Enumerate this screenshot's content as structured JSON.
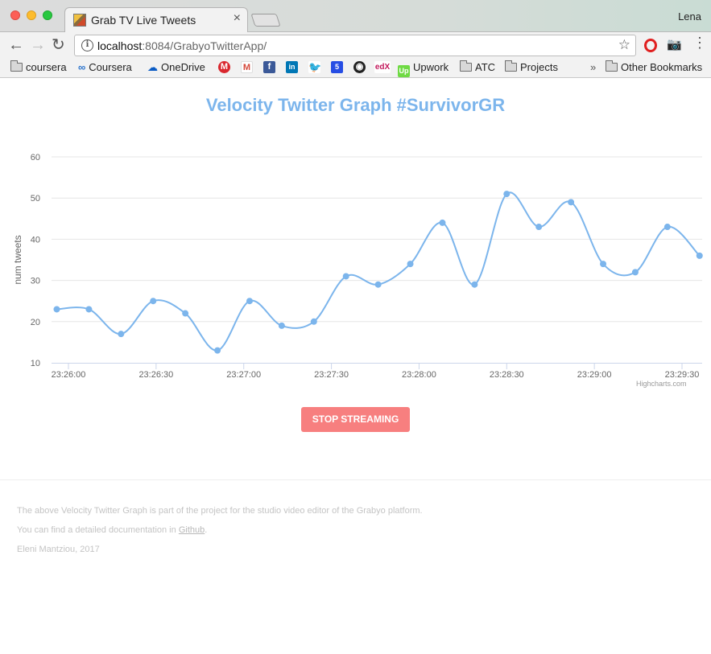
{
  "browser": {
    "tab_title": "Grab TV Live Tweets",
    "tab_close": "×",
    "profile_name": "Lena",
    "back_glyph": "←",
    "forward_glyph": "→",
    "reload_glyph": "↻",
    "info_glyph": "i",
    "url_host": "localhost",
    "url_rest": ":8084/GrabyoTwitterApp/",
    "star_glyph": "☆",
    "camera_glyph": "📷",
    "menu_glyph": "⋮",
    "bookmarks": {
      "coursera_folder": "coursera",
      "coursera": "Coursera",
      "onedrive": "OneDrive",
      "upwork": "Upwork",
      "atc": "ATC",
      "projects": "Projects",
      "overflow": "»",
      "other": "Other Bookmarks"
    },
    "bookmark_icons": [
      "mega-icon",
      "gmail-icon",
      "facebook-icon",
      "linkedin-icon",
      "twitter-icon",
      "html5-icon",
      "github-icon",
      "edx-icon",
      "upwork-icon"
    ]
  },
  "page": {
    "title": "Velocity Twitter Graph #SurvivorGR",
    "stop_button": "STOP STREAMING",
    "credits": "Highcharts.com",
    "footer": {
      "line1": "The above Velocity Twitter Graph is part of the project for the studio video editor of the Grabyo platform.",
      "line2_prefix": "You can find a detailed documentation in ",
      "line2_link": "Github",
      "line2_suffix": ".",
      "line3": "Eleni Mantziou, 2017"
    }
  },
  "colors": {
    "series": "#7cb5ec",
    "button": "#f77f7f",
    "grid": "#e6e6e6"
  },
  "chart_data": {
    "type": "line",
    "title": "Velocity Twitter Graph #SurvivorGR",
    "ylabel": "num tweets",
    "xlabel": "",
    "ylim": [
      10,
      60
    ],
    "yticks": [
      "10",
      "20",
      "30",
      "40",
      "50",
      "60"
    ],
    "xticks": [
      "23:26:00",
      "23:26:30",
      "23:27:00",
      "23:27:30",
      "23:28:00",
      "23:28:30",
      "23:29:00",
      "23:29:30"
    ],
    "grid": true,
    "legend": "none",
    "series": [
      {
        "x": [
          "23:25:56",
          "23:26:07",
          "23:26:18",
          "23:26:29",
          "23:26:40",
          "23:26:51",
          "23:27:02",
          "23:27:13",
          "23:27:24",
          "23:27:35",
          "23:27:46",
          "23:27:57",
          "23:28:08",
          "23:28:19",
          "23:28:30",
          "23:28:41",
          "23:28:52",
          "23:29:03",
          "23:29:14",
          "23:29:25",
          "23:29:36"
        ],
        "values": [
          23,
          23,
          17,
          25,
          22,
          13,
          25,
          19,
          20,
          31,
          29,
          34,
          44,
          29,
          51,
          43,
          49,
          34,
          32,
          43,
          36
        ]
      }
    ]
  }
}
